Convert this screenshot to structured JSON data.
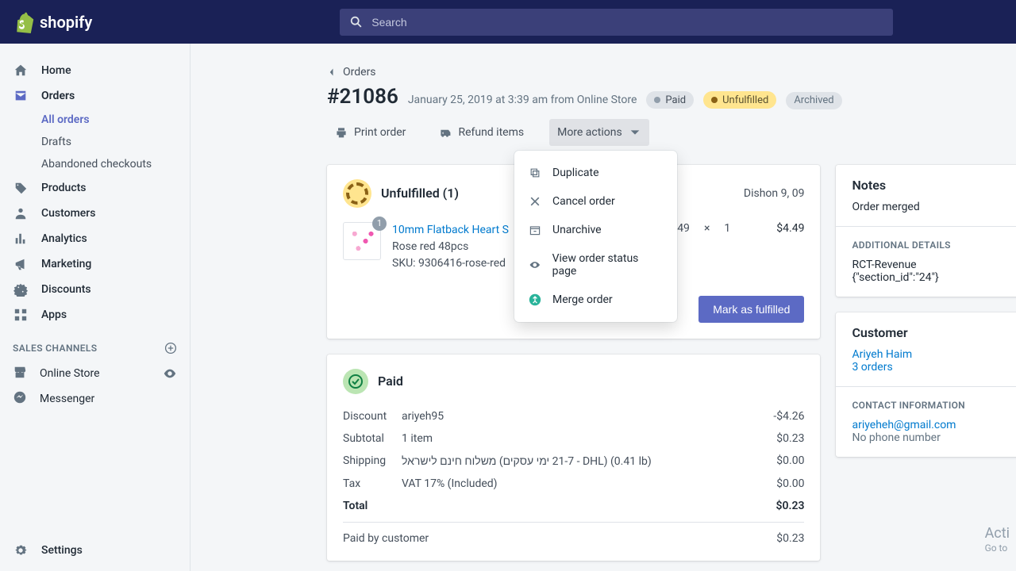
{
  "brand": {
    "name": "shopify"
  },
  "search": {
    "placeholder": "Search"
  },
  "nav": {
    "home": "Home",
    "orders": "Orders",
    "all_orders": "All orders",
    "drafts": "Drafts",
    "abandoned": "Abandoned checkouts",
    "products": "Products",
    "customers": "Customers",
    "analytics": "Analytics",
    "marketing": "Marketing",
    "discounts": "Discounts",
    "apps": "Apps",
    "sales_channels": "SALES CHANNELS",
    "online_store": "Online Store",
    "messenger": "Messenger",
    "settings": "Settings"
  },
  "breadcrumb": "Orders",
  "order": {
    "title": "#21086",
    "subtitle": "January 25, 2019 at 3:39 am from Online Store",
    "badges": {
      "paid": "Paid",
      "unfulfilled": "Unfulfilled",
      "archived": "Archived"
    }
  },
  "actions": {
    "print": "Print order",
    "refund": "Refund items",
    "more": "More actions",
    "menu": {
      "duplicate": "Duplicate",
      "cancel": "Cancel order",
      "unarchive": "Unarchive",
      "status": "View order status page",
      "merge": "Merge order"
    }
  },
  "unfulfilled": {
    "title": "Unfulfilled (1)",
    "ship_to": "Dishon 9, 09",
    "item": {
      "count": "1",
      "name": "10mm Flatback Heart S",
      "variant": "Rose red 48pcs",
      "sku": "SKU: 9306416-rose-red",
      "price_trunc": "49",
      "multiply": "×",
      "qty": "1",
      "line_total": "$4.49"
    },
    "button": "Mark as fulfilled"
  },
  "paid": {
    "title": "Paid",
    "rows": {
      "discount": {
        "label": "Discount",
        "desc": "ariyeh95",
        "val": "-$4.26"
      },
      "subtotal": {
        "label": "Subtotal",
        "desc": "1 item",
        "val": "$0.23"
      },
      "shipping": {
        "label": "Shipping",
        "desc": "משלוח חינם לישראל (21-7 ימי עסקים - DHL) (0.41 lb)",
        "val": "$0.00"
      },
      "tax": {
        "label": "Tax",
        "desc": "VAT 17% (Included)",
        "val": "$0.00"
      },
      "total": {
        "label": "Total",
        "val": "$0.23"
      },
      "paid_by": {
        "label": "Paid by customer",
        "val": "$0.23"
      }
    }
  },
  "notes": {
    "title": "Notes",
    "body": "Order merged"
  },
  "details": {
    "title": "ADDITIONAL DETAILS",
    "line1": "RCT-Revenue",
    "line2": "{\"section_id\":\"24\"}"
  },
  "customer": {
    "title": "Customer",
    "name": "Ariyeh Haim",
    "orders": "3 orders"
  },
  "contact": {
    "title": "CONTACT INFORMATION",
    "email": "ariyeheh@gmail.com",
    "phone": "No phone number"
  },
  "watermark": {
    "l1": "Acti",
    "l2": "Go to"
  }
}
